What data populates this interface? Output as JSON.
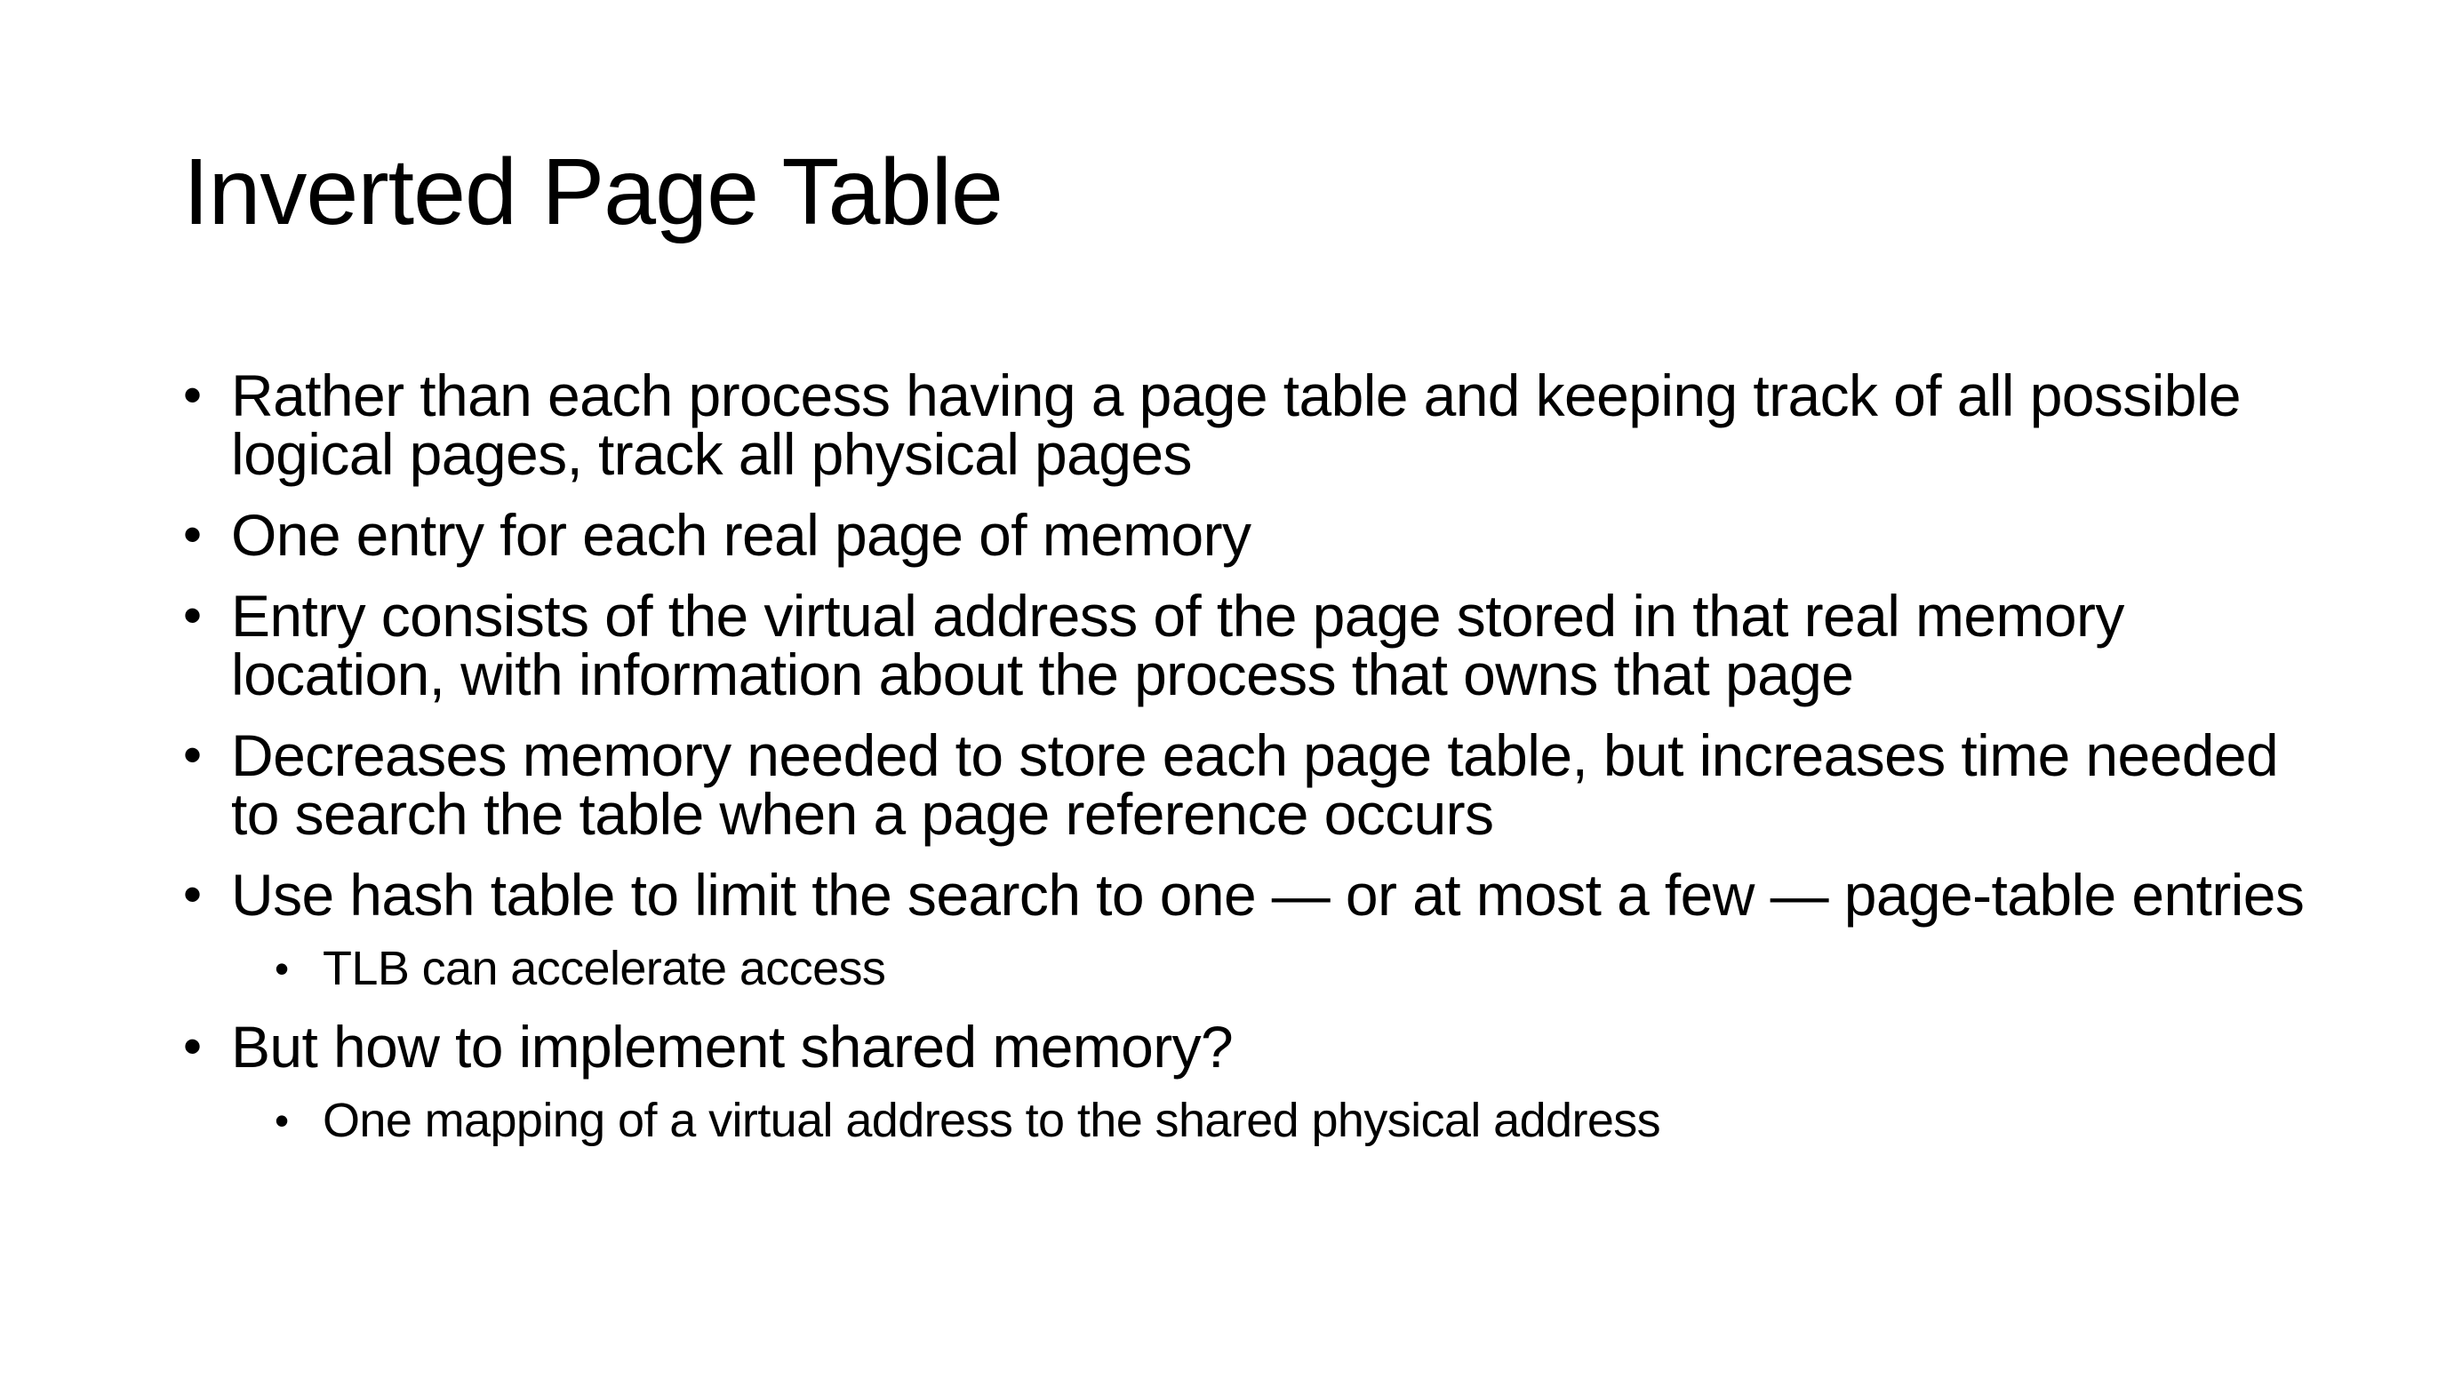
{
  "slide": {
    "title": "Inverted Page Table",
    "bullet_char": "•",
    "bullets": [
      "Rather than each process having a page table and keeping track of all possible logical pages, track all physical pages",
      "One entry for each real page of memory",
      "Entry consists of the virtual address of the page stored in that real memory location, with information about the process that owns that page",
      "Decreases memory needed to store each page table, but increases time needed to search the table when a page reference occurs",
      "Use hash table to limit the search to one — or at most a few — page-table entries",
      "But how to implement shared memory?"
    ],
    "sub_bullets": [
      "TLB can accelerate access",
      "One mapping of a virtual address to the shared physical address"
    ]
  }
}
